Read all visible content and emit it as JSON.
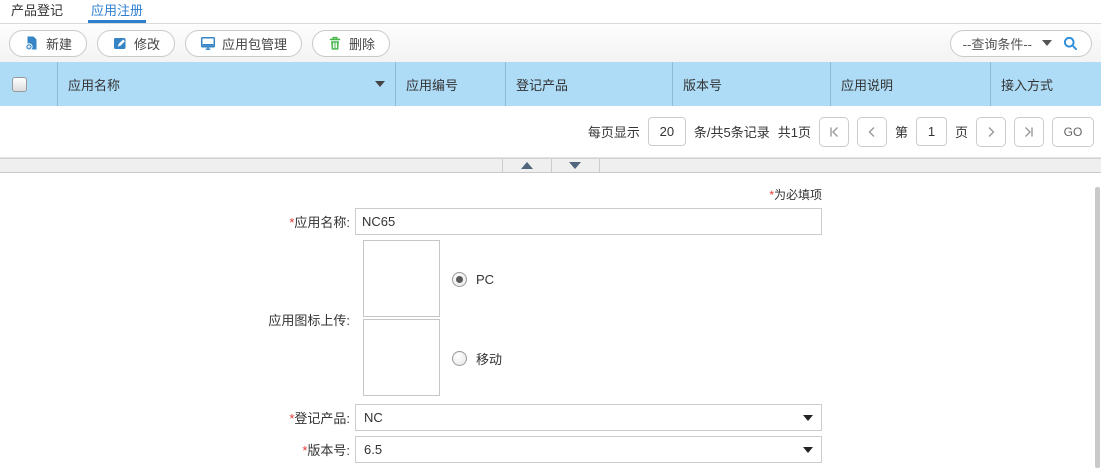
{
  "tabs": [
    {
      "label": "产品登记",
      "active": false
    },
    {
      "label": "应用注册",
      "active": true
    }
  ],
  "toolbar": {
    "buttons": [
      {
        "label": "新建",
        "icon": "new-doc-icon"
      },
      {
        "label": "修改",
        "icon": "edit-icon"
      },
      {
        "label": "应用包管理",
        "icon": "monitor-icon"
      },
      {
        "label": "删除",
        "icon": "trash-icon"
      }
    ],
    "query_dropdown": {
      "value": "--查询条件--",
      "icon": "search-icon"
    }
  },
  "table": {
    "columns": [
      {
        "label": "应用名称",
        "sortable": true
      },
      {
        "label": "应用编号"
      },
      {
        "label": "登记产品"
      },
      {
        "label": "版本号"
      },
      {
        "label": "应用说明"
      },
      {
        "label": "接入方式"
      }
    ]
  },
  "pagination": {
    "per_page_label": "每页显示",
    "per_page_value": "20",
    "records_text": "条/共5条记录",
    "total_pages_text": "共1页",
    "page_prefix": "第",
    "current_page": "1",
    "page_suffix": "页",
    "go_label": "GO"
  },
  "form": {
    "required_note": {
      "asterisk": "*",
      "text": "为必填项"
    },
    "app_name": {
      "required": "*",
      "label": "应用名称:",
      "value": "NC65"
    },
    "icon_upload": {
      "label": "应用图标上传:",
      "radios": [
        {
          "label": "PC",
          "selected": true
        },
        {
          "label": "移动",
          "selected": false
        }
      ]
    },
    "product": {
      "required": "*",
      "label": "登记产品:",
      "value": "NC"
    },
    "version": {
      "required": "*",
      "label": "版本号:",
      "value": "6.5"
    }
  },
  "colors": {
    "accent_blue": "#3585c6",
    "tab_blue": "#2e7fd0",
    "header_bg": "#aedcf7",
    "trash_green": "#44b549",
    "required_red": "#e53935"
  }
}
